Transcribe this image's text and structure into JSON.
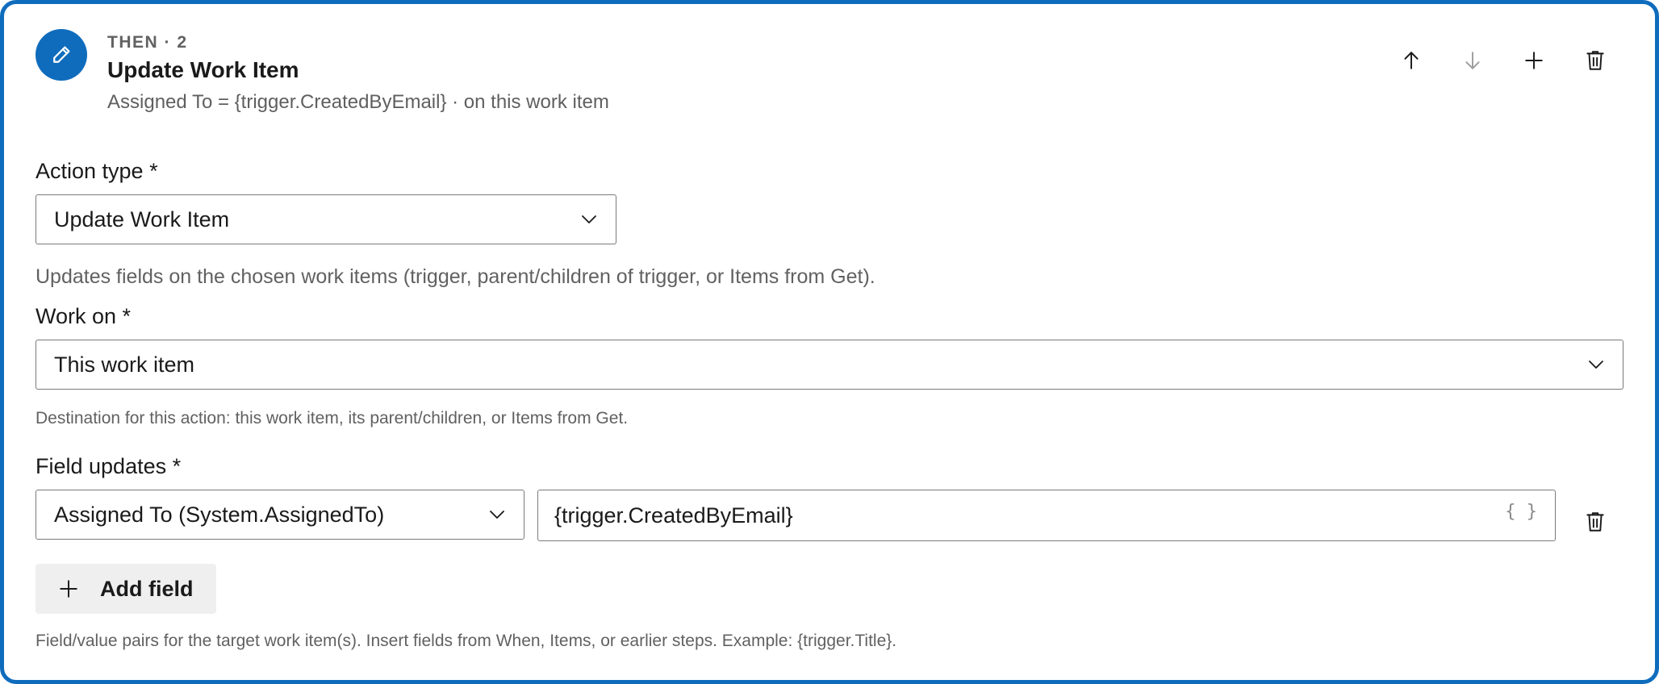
{
  "header": {
    "eyebrow": "THEN · 2",
    "title": "Update Work Item",
    "summary": "Assigned To = {trigger.CreatedByEmail} · on this work item",
    "step_icon": "pencil-icon",
    "actions": [
      "move-up-icon",
      "move-down-icon",
      "add-icon",
      "delete-icon"
    ]
  },
  "action_type": {
    "label": "Action type *",
    "value": "Update Work Item",
    "help": "Updates fields on the chosen work items (trigger, parent/children of trigger, or Items from Get)."
  },
  "work_on": {
    "label": "Work on *",
    "value": "This work item",
    "help": "Destination for this action: this work item, its parent/children, or Items from Get."
  },
  "field_updates": {
    "label": "Field updates *",
    "rows": [
      {
        "field": "Assigned To (System.AssignedTo)",
        "value": "{trigger.CreatedByEmail}",
        "insert_icon": "{ }"
      }
    ],
    "add_label": "Add field",
    "help": "Field/value pairs for the target work item(s). Insert fields from When, Items, or earlier steps. Example: {trigger.Title}."
  },
  "colors": {
    "accent": "#0f6cbd",
    "muted": "#616161",
    "border": "#7a7a7a",
    "disabled": "#9e9e9e"
  }
}
